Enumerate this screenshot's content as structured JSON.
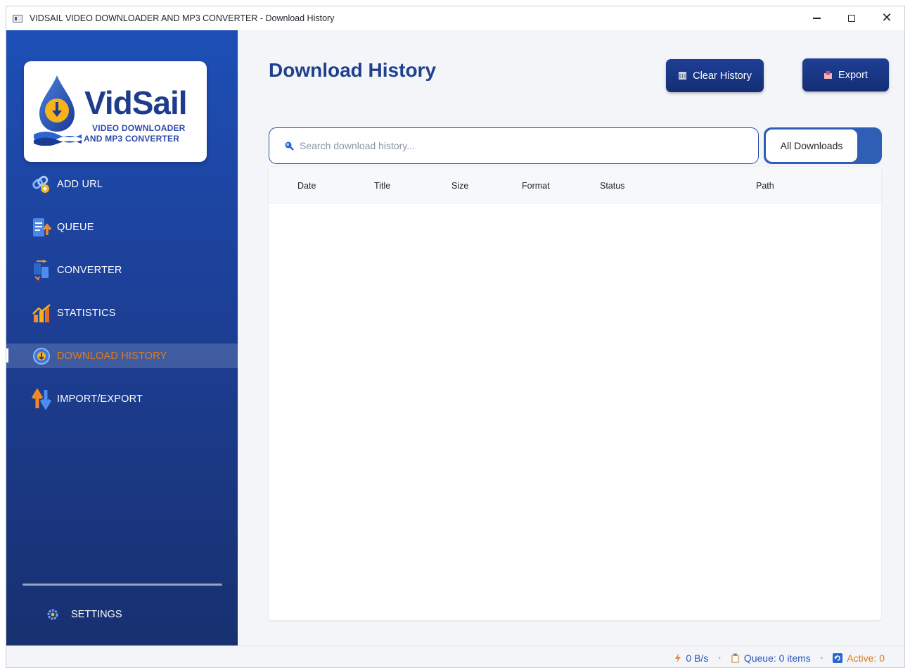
{
  "window": {
    "title": "VIDSAIL VIDEO DOWNLOADER AND MP3 CONVERTER - Download History"
  },
  "logo": {
    "name": "VidSail",
    "line1": "VIDEO DOWNLOADER",
    "line2": "AND MP3 CONVERTER"
  },
  "sidebar": {
    "items": [
      {
        "label": "ADD URL",
        "icon": "link-add-icon"
      },
      {
        "label": "QUEUE",
        "icon": "queue-upload-icon"
      },
      {
        "label": "CONVERTER",
        "icon": "convert-arrows-icon"
      },
      {
        "label": "STATISTICS",
        "icon": "bar-chart-icon"
      },
      {
        "label": "DOWNLOAD HISTORY",
        "icon": "history-download-icon",
        "active": true
      },
      {
        "label": "IMPORT/EXPORT",
        "icon": "up-down-arrows-icon"
      }
    ],
    "settings_label": "SETTINGS"
  },
  "main": {
    "title": "Download History",
    "clear_label": "Clear History",
    "export_label": "Export",
    "search_placeholder": "Search download history...",
    "filter_value": "All Downloads",
    "columns": [
      "Date",
      "Title",
      "Size",
      "Format",
      "Status",
      "Path"
    ]
  },
  "status": {
    "speed": "0 B/s",
    "queue": "Queue: 0 items",
    "active": "Active: 0"
  },
  "colors": {
    "sidebar_top": "#1d4fb6",
    "sidebar_bottom": "#17306f",
    "accent": "#1f3f8f",
    "active_status": "#e07a1a"
  }
}
